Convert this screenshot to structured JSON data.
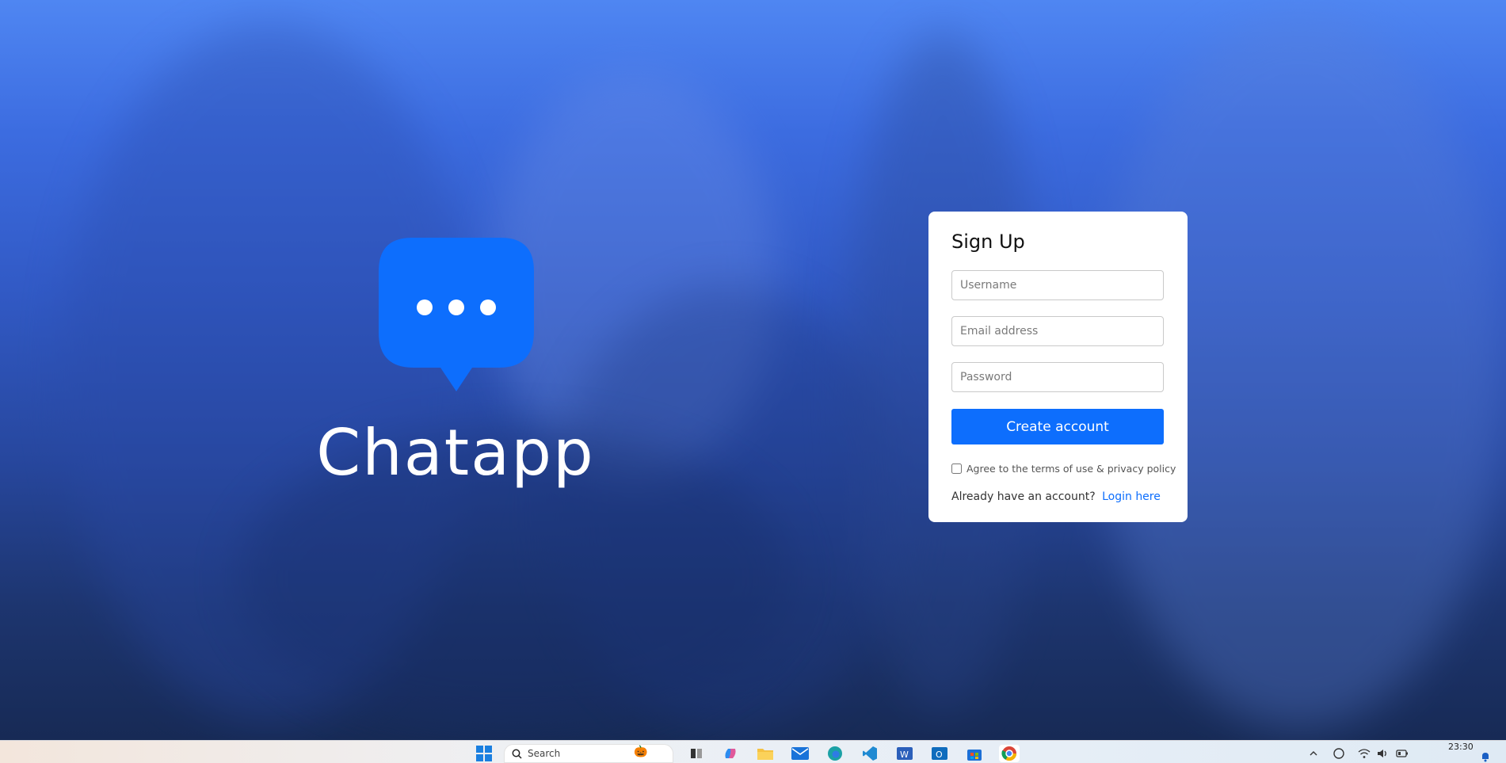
{
  "brand": {
    "name": "Chatapp",
    "logo_icon": "chat-bubble-icon",
    "logo_color": "#0d6efd"
  },
  "signup": {
    "title": "Sign Up",
    "username_placeholder": "Username",
    "email_placeholder": "Email address",
    "password_placeholder": "Password",
    "submit_label": "Create account",
    "terms_label": "Agree to the terms of use & privacy policy",
    "terms_checked": false,
    "login_prompt": "Already have an account?",
    "login_link": "Login here"
  },
  "colors": {
    "accent": "#0d6efd",
    "hero_top": "#4f86f2",
    "hero_bottom": "#172a55"
  },
  "taskbar": {
    "search_placeholder": "Search",
    "clock_time": "23:30",
    "pinned_apps": [
      "windows-start-icon",
      "task-view-icon",
      "copilot-icon",
      "file-explorer-icon",
      "mail-icon",
      "edge-icon",
      "vscode-icon",
      "word-icon",
      "outlook-icon",
      "store-icon",
      "chrome-icon"
    ],
    "tray_icons": [
      "chevron-up-icon",
      "security-icon",
      "wifi-icon",
      "volume-icon",
      "battery-icon",
      "notification-icon"
    ]
  }
}
